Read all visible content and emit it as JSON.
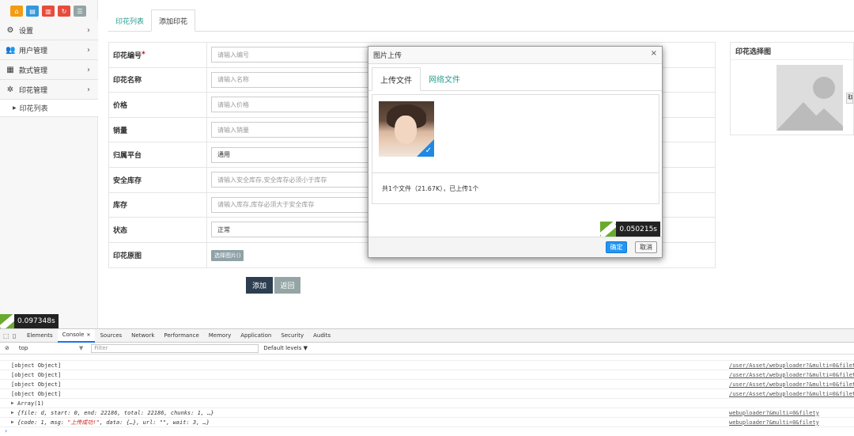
{
  "colors": {
    "accent": "#2a9d8f",
    "primary_btn": "#2c3e50",
    "secondary_btn": "#95a5a6",
    "ok_btn": "#2196f3",
    "timer_green": "#6aaa2f"
  },
  "quick_buttons": [
    {
      "icon": "home-icon",
      "color": "#f39c12"
    },
    {
      "icon": "document-icon",
      "color": "#3498db"
    },
    {
      "icon": "trash-icon",
      "color": "#e74c3c"
    },
    {
      "icon": "refresh-icon",
      "color": "#e74c3c"
    },
    {
      "icon": "list-icon",
      "color": "#95a5a6"
    }
  ],
  "sidebar": {
    "items": [
      {
        "label": "设置",
        "icon": "gears-icon"
      },
      {
        "label": "用户管理",
        "icon": "users-icon"
      },
      {
        "label": "款式管理",
        "icon": "grid-icon"
      },
      {
        "label": "印花管理",
        "icon": "print-icon"
      }
    ],
    "sub_items": [
      {
        "label": "印花列表"
      }
    ],
    "timer": "0.097348s"
  },
  "tabs": [
    {
      "label": "印花列表"
    },
    {
      "label": "添加印花"
    }
  ],
  "form": {
    "rows": [
      {
        "label": "印花编号",
        "required": "*",
        "placeholder": "请输入编号"
      },
      {
        "label": "印花名称",
        "placeholder": "请输入名称"
      },
      {
        "label": "价格",
        "placeholder": "请输入价格"
      },
      {
        "label": "销量",
        "placeholder": "请输入销量"
      },
      {
        "label": "归属平台",
        "value": "通用"
      },
      {
        "label": "安全库存",
        "placeholder": "请输入安全库存,安全库存必须小于库存"
      },
      {
        "label": "库存",
        "placeholder": "请输入库存,库存必须大于安全库存"
      },
      {
        "label": "状态",
        "value": "正常"
      },
      {
        "label": "印花原图",
        "button": "选择图片()"
      }
    ],
    "add_label": "添加",
    "back_label": "返回"
  },
  "preview": {
    "title": "印花选择图",
    "cut_label": "取"
  },
  "modal": {
    "title": "图片上传",
    "close": "×",
    "tabs": [
      {
        "label": "上传文件"
      },
      {
        "label": "网络文件"
      }
    ],
    "status": "共1个文件（21.67K），已上传1个",
    "timer": "0.050215s",
    "ok_label": "确定",
    "cancel_label": "取消"
  },
  "devtools": {
    "tabs": [
      "Elements",
      "Console",
      "Sources",
      "Network",
      "Performance",
      "Memory",
      "Application",
      "Security",
      "Audits"
    ],
    "context": "top",
    "filter_placeholder": "Filter",
    "levels": "Default levels ▼",
    "logs": [
      {
        "text": "[object Object]",
        "src": "/user/Asset/webuploader?&multi=0&filetype"
      },
      {
        "text": "[object Object]",
        "src": "/user/Asset/webuploader?&multi=0&filetype"
      },
      {
        "text": "[object Object]",
        "src": "/user/Asset/webuploader?&multi=0&filetype"
      },
      {
        "text": "[object Object]",
        "src": "/user/Asset/webuploader?&multi=0&filetype"
      },
      {
        "text": "Array(1)",
        "src": ""
      },
      {
        "text": "{file: d, start: 0, end: 22186, total: 22186, chunks: 1, …}",
        "src": "webuploader?&multi=0&filety"
      },
      {
        "text_pre": "{code: 1, msg: ",
        "text_str": "\"上传成功!\"",
        "text_post": ", data: {…}, url: \"\", wait: 3, …}",
        "src": "webuploader?&multi=0&filety"
      }
    ]
  }
}
